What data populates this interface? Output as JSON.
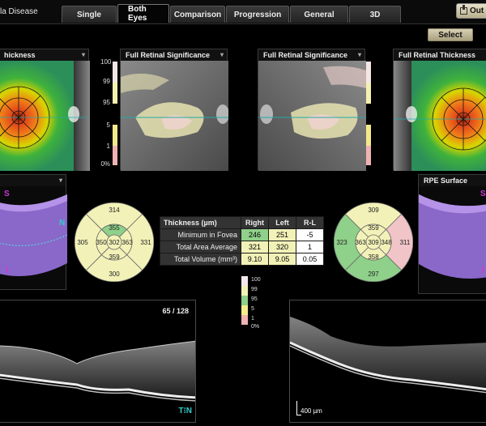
{
  "app": {
    "title": "la Disease"
  },
  "tabs": [
    {
      "label": "Single",
      "active": false
    },
    {
      "label": "Both Eyes",
      "active": true
    },
    {
      "label": "Comparison",
      "active": false
    },
    {
      "label": "Progression",
      "active": false
    },
    {
      "label": "General",
      "active": false
    },
    {
      "label": "3D",
      "active": false
    }
  ],
  "toolbar": {
    "output_label": "Out",
    "select_label": "Select"
  },
  "panels": {
    "left_thickness": {
      "title": "hickness"
    },
    "left_significance": {
      "title": "Full Retinal Significance"
    },
    "right_significance": {
      "title": "Full Retinal Significance"
    },
    "right_thickness": {
      "title": "Full Retinal Thickness"
    },
    "left_3d": {
      "title": "",
      "s_label": "S",
      "i_label": "I",
      "n_label": "N"
    },
    "right_3d": {
      "title": "RPE Surface",
      "s_label": "S",
      "i_label": "I"
    }
  },
  "significance_legend": {
    "labels": [
      "100",
      "99",
      "95",
      "5",
      "1",
      "0%"
    ],
    "colors": [
      "#f5e6e6",
      "#f6f0b0",
      "#1a1a1a",
      "#f3e98a",
      "#f0b3b3"
    ]
  },
  "etdrs_right": {
    "center": "302",
    "inner": {
      "top": "355",
      "right": "363",
      "bottom": "359",
      "left": "350"
    },
    "outer": {
      "top": "314",
      "right": "331",
      "bottom": "300",
      "left": "305"
    },
    "colors": {
      "normal": "#f2f2b8",
      "green": "#8fd08a",
      "pink": "#f1c4c8"
    }
  },
  "etdrs_left": {
    "center": "309",
    "inner": {
      "top": "359",
      "right": "348",
      "bottom": "358",
      "left": "363"
    },
    "outer": {
      "top": "309",
      "right": "311",
      "bottom": "297",
      "left": "323"
    }
  },
  "thickness_table": {
    "headers": [
      "Thickness (µm)",
      "Right",
      "Left",
      "R-L"
    ],
    "rows": [
      {
        "label": "Minimum in Fovea",
        "right": "246",
        "left": "251",
        "rl": "-5",
        "right_color": "#8fd08a",
        "left_color": "#f2f2b8",
        "rl_color": "#ffffff"
      },
      {
        "label": "Total Area Average",
        "right": "321",
        "left": "320",
        "rl": "1",
        "right_color": "#f2f2b8",
        "left_color": "#f2f2b8",
        "rl_color": "#ffffff"
      },
      {
        "label": "Total Volume (mm³)",
        "right": "9.10",
        "left": "9.05",
        "rl": "0.05",
        "right_color": "#f2f2b8",
        "left_color": "#f2f2b8",
        "rl_color": "#ffffff"
      }
    ]
  },
  "mini_legend": {
    "labels": [
      "100",
      "99",
      "95",
      "5",
      "1",
      "0%"
    ],
    "colors": [
      "#f7e8ec",
      "#f2f2b8",
      "#8fd08a",
      "#f5ec8c",
      "#f0b3b3"
    ]
  },
  "oct_left": {
    "frame": "65 / 128",
    "tn": "T⁝N"
  },
  "oct_right": {
    "scale": "400 µm"
  }
}
